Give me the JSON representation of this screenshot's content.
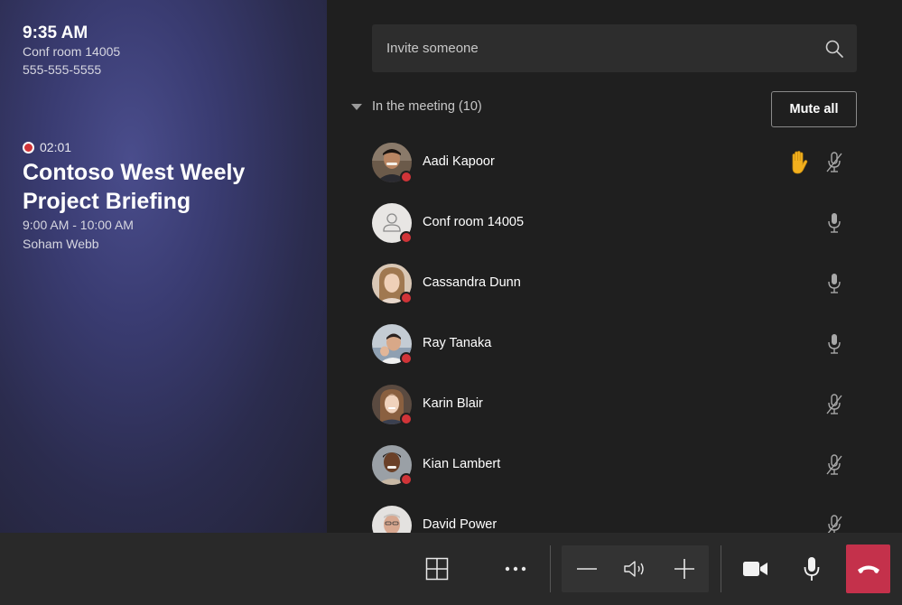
{
  "device": {
    "time": "9:35 AM",
    "room_name": "Conf room 14005",
    "room_phone": "555-555-5555"
  },
  "meeting": {
    "recording_time": "02:01",
    "title": "Contoso West Weely Project Briefing",
    "time_range": "9:00 AM - 10:00 AM",
    "organizer": "Soham Webb"
  },
  "invite": {
    "placeholder": "Invite someone",
    "icon": "search-icon"
  },
  "participants_section": {
    "title": "In the meeting (10)",
    "mute_all_label": "Mute all"
  },
  "participants": [
    {
      "name": "Aadi Kapoor",
      "hand_raised": true,
      "mic": "muted",
      "avatar": "photo"
    },
    {
      "name": "Conf room 14005",
      "hand_raised": false,
      "mic": "on",
      "avatar": "room-icon"
    },
    {
      "name": "Cassandra Dunn",
      "hand_raised": false,
      "mic": "on",
      "avatar": "photo"
    },
    {
      "name": "Ray Tanaka",
      "hand_raised": false,
      "mic": "on",
      "avatar": "photo"
    },
    {
      "name": "Karin Blair",
      "hand_raised": false,
      "mic": "muted",
      "avatar": "photo"
    },
    {
      "name": "Kian Lambert",
      "hand_raised": false,
      "mic": "muted",
      "avatar": "photo"
    },
    {
      "name": "David Power",
      "hand_raised": false,
      "mic": "muted",
      "avatar": "photo"
    }
  ],
  "toolbar": {
    "icons": [
      "gallery-layout-icon",
      "more-options-icon",
      "volume-down-icon",
      "speaker-icon",
      "volume-up-icon",
      "camera-icon",
      "microphone-icon",
      "hang-up-icon"
    ]
  },
  "colors": {
    "hangup": "#c4314b",
    "status_dot": "#d13438",
    "raised_hand": "#f2b01e"
  }
}
